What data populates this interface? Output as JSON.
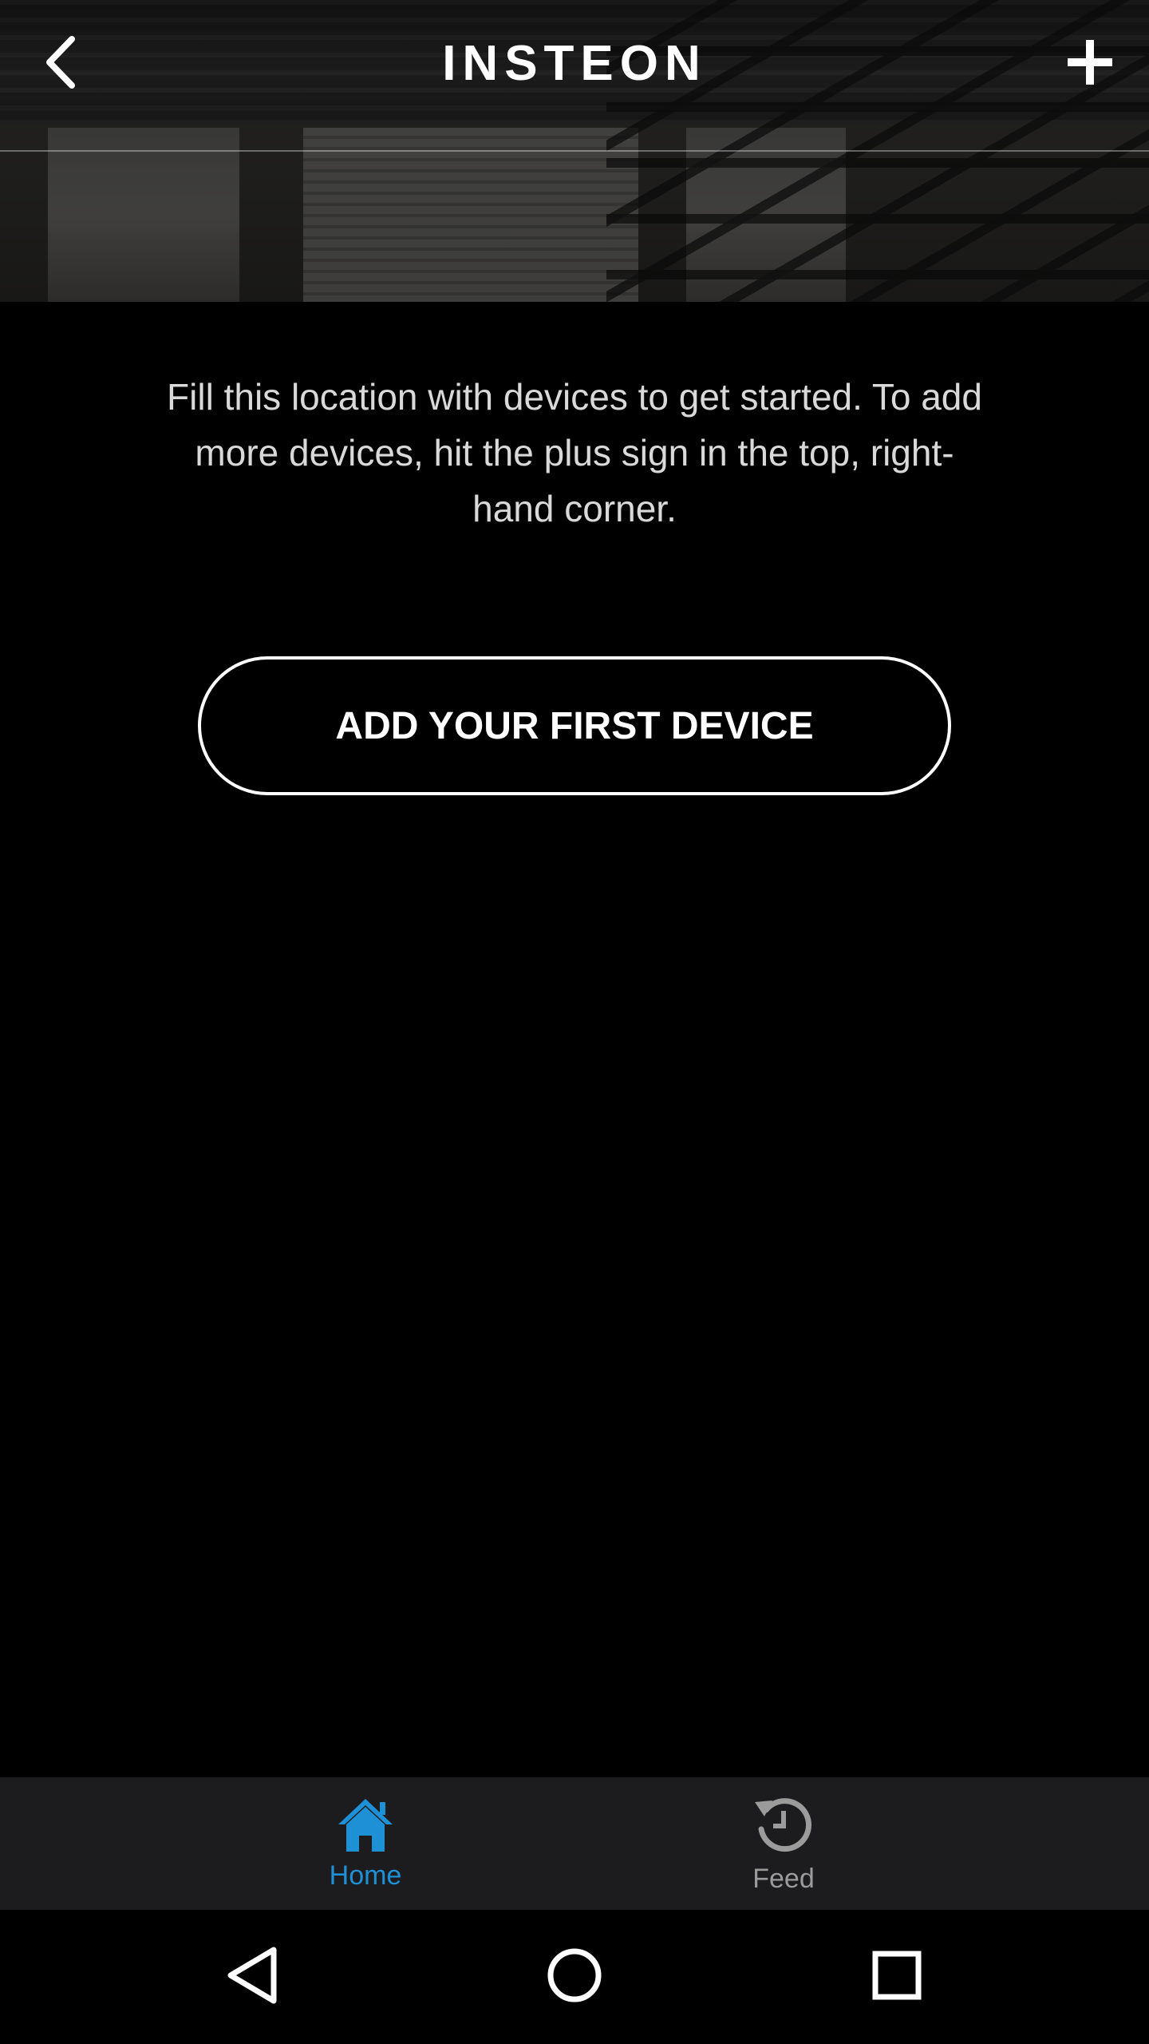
{
  "header": {
    "title": "INSTEON",
    "back_icon": "chevron-left-icon",
    "add_icon": "plus-icon"
  },
  "main": {
    "intro_text": "Fill this location with devices to get started. To add more devices, hit the plus sign in the top, right-hand corner.",
    "add_first_device_label": "ADD YOUR FIRST DEVICE"
  },
  "tabbar": {
    "tabs": [
      {
        "label": "Home",
        "icon": "house-icon",
        "active": true,
        "color": "#1e90d6"
      },
      {
        "label": "Feed",
        "icon": "history-icon",
        "active": false,
        "color": "#9b9b9b"
      }
    ]
  },
  "system_nav": {
    "back_icon": "triangle-back-icon",
    "home_icon": "circle-home-icon",
    "recents_icon": "square-recents-icon"
  },
  "colors": {
    "background": "#000000",
    "accent": "#1e90d6",
    "tabbar_bg": "#1c1c1e",
    "text_primary": "#ffffff",
    "text_secondary": "#d9d9d9"
  }
}
